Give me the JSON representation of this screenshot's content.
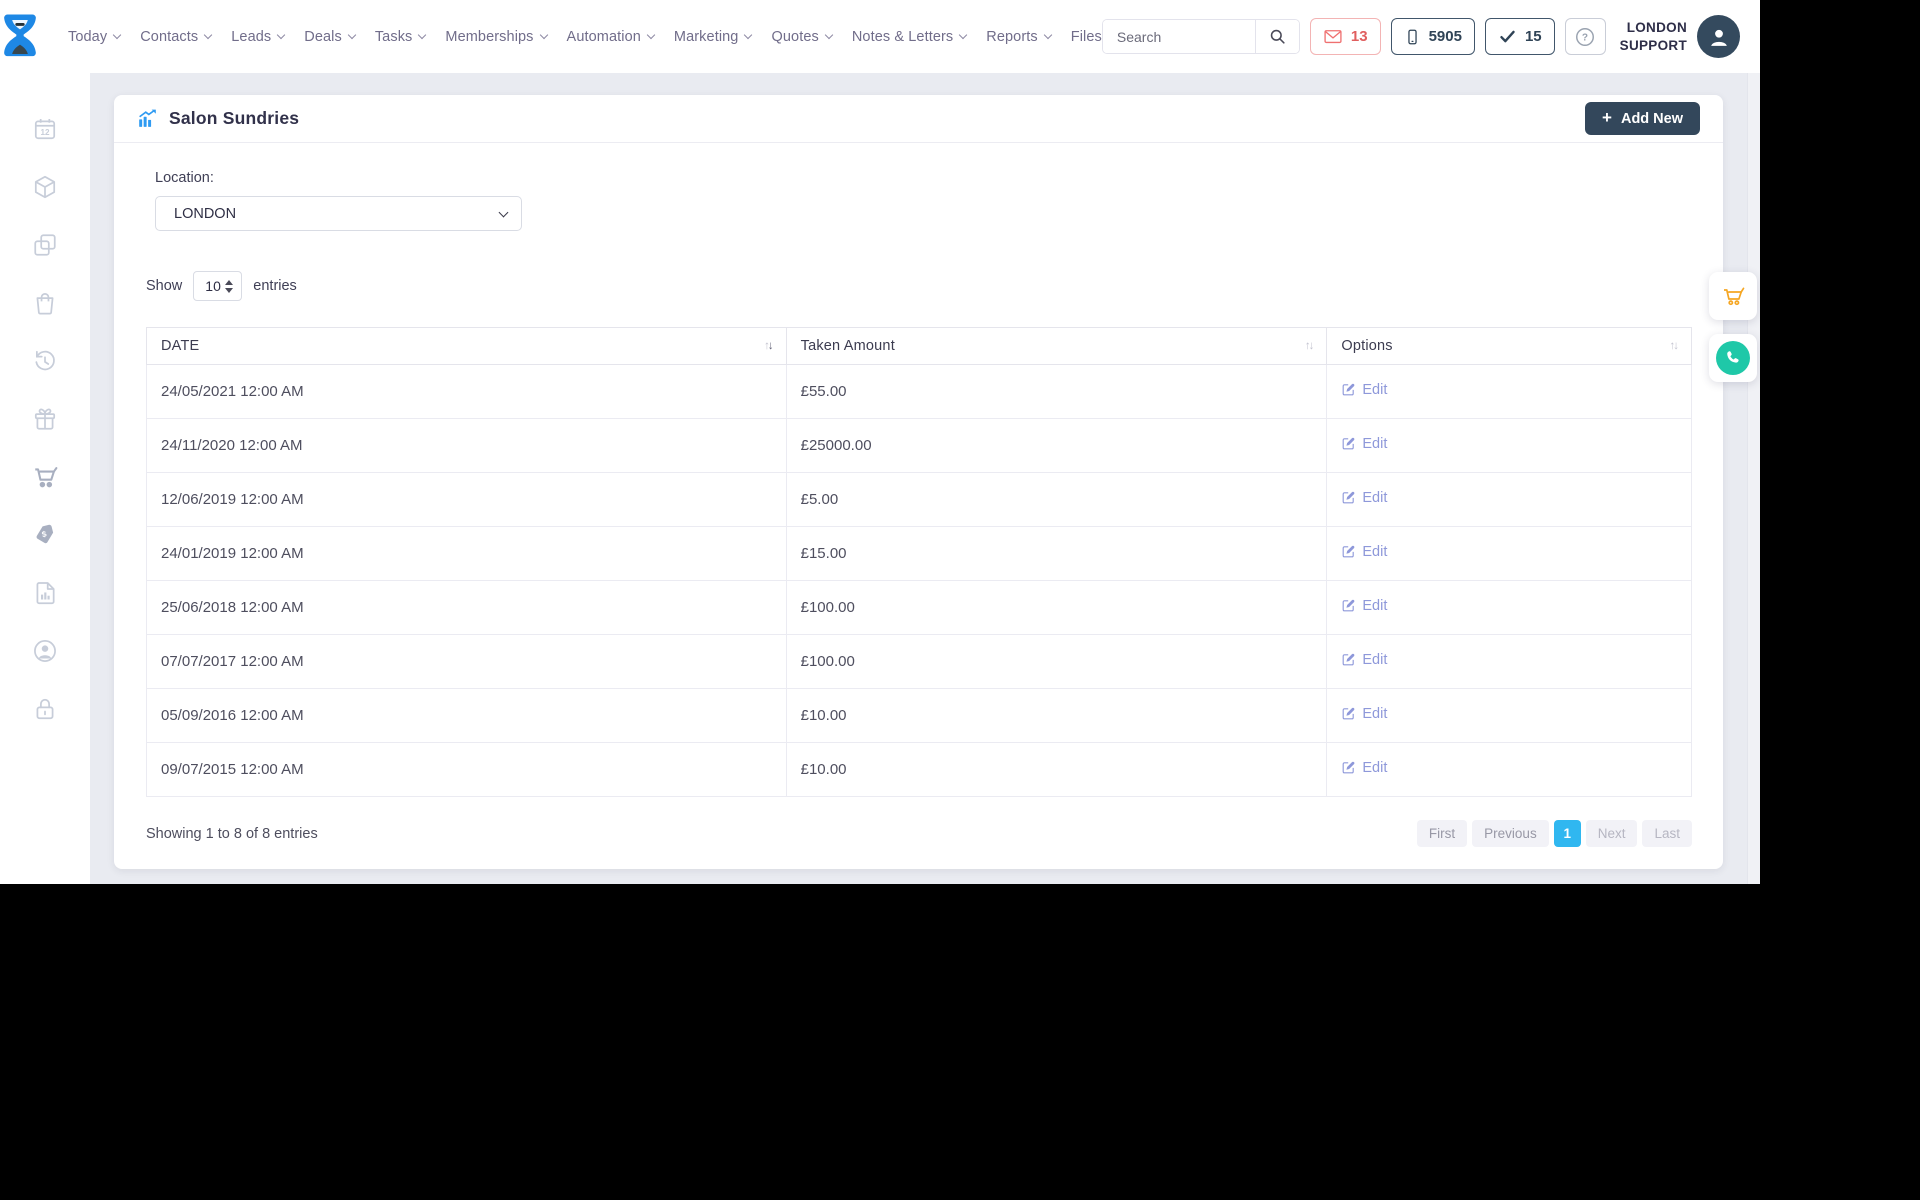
{
  "header": {
    "search_placeholder": "Search",
    "nav": [
      {
        "label": "Today"
      },
      {
        "label": "Contacts"
      },
      {
        "label": "Leads"
      },
      {
        "label": "Deals"
      },
      {
        "label": "Tasks"
      },
      {
        "label": "Memberships"
      },
      {
        "label": "Automation"
      },
      {
        "label": "Marketing"
      },
      {
        "label": "Quotes"
      },
      {
        "label": "Notes & Letters"
      },
      {
        "label": "Reports"
      },
      {
        "label": "Files"
      }
    ],
    "badges": {
      "messages": "13",
      "phone": "5905",
      "tasks": "15"
    },
    "user": {
      "name_line1": "LONDON",
      "name_line2": "SUPPORT"
    }
  },
  "sidebar": {
    "icons": [
      "calendar-icon",
      "cube-icon",
      "copy-icon",
      "shopping-bag-icon",
      "history-icon",
      "gift-icon",
      "cart-icon",
      "price-tag-icon",
      "report-icon",
      "user-circle-icon",
      "lock-icon"
    ]
  },
  "page": {
    "title": "Salon Sundries",
    "add_new_label": "Add New",
    "location_label": "Location:",
    "location_value": "LONDON",
    "show_label": "Show",
    "show_value": "10",
    "entries_label": "entries",
    "table": {
      "columns": {
        "date": "DATE",
        "amount": "Taken Amount",
        "options": "Options"
      },
      "rows": [
        {
          "date": "24/05/2021 12:00 AM",
          "amount": "£55.00",
          "action": "Edit"
        },
        {
          "date": "24/11/2020 12:00 AM",
          "amount": "£25000.00",
          "action": "Edit"
        },
        {
          "date": "12/06/2019 12:00 AM",
          "amount": "£5.00",
          "action": "Edit"
        },
        {
          "date": "24/01/2019 12:00 AM",
          "amount": "£15.00",
          "action": "Edit"
        },
        {
          "date": "25/06/2018 12:00 AM",
          "amount": "£100.00",
          "action": "Edit"
        },
        {
          "date": "07/07/2017 12:00 AM",
          "amount": "£100.00",
          "action": "Edit"
        },
        {
          "date": "05/09/2016 12:00 AM",
          "amount": "£10.00",
          "action": "Edit"
        },
        {
          "date": "09/07/2015 12:00 AM",
          "amount": "£10.00",
          "action": "Edit"
        }
      ]
    },
    "footer": {
      "summary": "Showing 1 to 8 of 8 entries",
      "pagination": [
        {
          "label": "First"
        },
        {
          "label": "Previous"
        },
        {
          "label": "1",
          "active": true
        },
        {
          "label": "Next"
        },
        {
          "label": "Last"
        }
      ]
    }
  },
  "icons": {
    "sort_up": "↑",
    "sort_down": "↓",
    "plus": "+",
    "question": "?"
  },
  "colors": {
    "accent_blue": "#30b7f0",
    "navy": "#33475b",
    "red_badge": "#e05f5f",
    "edit_link": "#8e98da",
    "cart_orange": "#f5a623",
    "phone_teal": "#1fc8a8",
    "logo_blue": "#1e88e5",
    "page_bg": "#e9ebf1"
  }
}
